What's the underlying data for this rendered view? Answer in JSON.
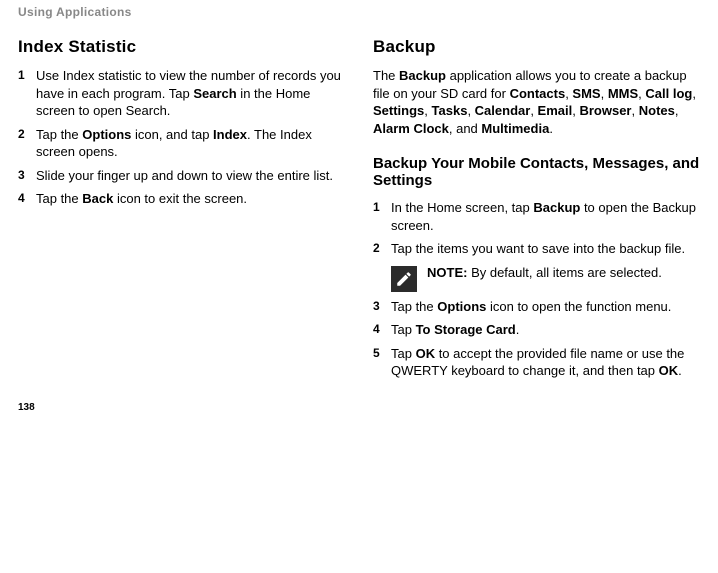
{
  "header": "Using Applications",
  "pageNumber": "138",
  "left": {
    "title": "Index Statistic",
    "steps": [
      {
        "n": "1",
        "parts": [
          {
            "t": "Use Index statistic to view the number of records you have in each program. Tap "
          },
          {
            "t": "Search",
            "b": true
          },
          {
            "t": " in the Home screen to open Search."
          }
        ]
      },
      {
        "n": "2",
        "parts": [
          {
            "t": "Tap the "
          },
          {
            "t": "Options",
            "b": true
          },
          {
            "t": " icon, and tap "
          },
          {
            "t": "Index",
            "b": true
          },
          {
            "t": ". The Index screen opens."
          }
        ]
      },
      {
        "n": "3",
        "parts": [
          {
            "t": "Slide your finger up and down to view the entire list."
          }
        ]
      },
      {
        "n": "4",
        "parts": [
          {
            "t": "Tap the "
          },
          {
            "t": "Back",
            "b": true
          },
          {
            "t": " icon to exit the screen."
          }
        ]
      }
    ]
  },
  "right": {
    "title": "Backup",
    "introParts": [
      {
        "t": "The "
      },
      {
        "t": "Backup",
        "b": true
      },
      {
        "t": " application allows you to create a backup file on your SD card for "
      },
      {
        "t": "Contacts",
        "b": true
      },
      {
        "t": ", "
      },
      {
        "t": "SMS",
        "b": true
      },
      {
        "t": ", "
      },
      {
        "t": "MMS",
        "b": true
      },
      {
        "t": ", "
      },
      {
        "t": "Call log",
        "b": true
      },
      {
        "t": ", "
      },
      {
        "t": "Settings",
        "b": true
      },
      {
        "t": ", "
      },
      {
        "t": "Tasks",
        "b": true
      },
      {
        "t": ", "
      },
      {
        "t": "Calendar",
        "b": true
      },
      {
        "t": ", "
      },
      {
        "t": "Email",
        "b": true
      },
      {
        "t": ", "
      },
      {
        "t": "Browser",
        "b": true
      },
      {
        "t": ", "
      },
      {
        "t": "Notes",
        "b": true
      },
      {
        "t": ", "
      },
      {
        "t": "Alarm Clock",
        "b": true
      },
      {
        "t": ", and "
      },
      {
        "t": "Multimedia",
        "b": true
      },
      {
        "t": "."
      }
    ],
    "subTitle": "Backup Your Mobile Contacts, Messages, and Settings",
    "steps": [
      {
        "n": "1",
        "parts": [
          {
            "t": "In the Home screen, tap "
          },
          {
            "t": "Backup",
            "b": true
          },
          {
            "t": " to open the Backup screen."
          }
        ]
      },
      {
        "n": "2",
        "parts": [
          {
            "t": "Tap the items you want to save into the backup file."
          }
        ]
      },
      {
        "note": {
          "labelParts": [
            {
              "t": "NOTE:",
              "b": true
            },
            {
              "t": " By default, all items are selected."
            }
          ]
        }
      },
      {
        "n": "3",
        "parts": [
          {
            "t": "Tap the "
          },
          {
            "t": "Options",
            "b": true
          },
          {
            "t": " icon to open the function menu."
          }
        ]
      },
      {
        "n": "4",
        "parts": [
          {
            "t": "Tap "
          },
          {
            "t": "To Storage Card",
            "b": true
          },
          {
            "t": "."
          }
        ]
      },
      {
        "n": "5",
        "parts": [
          {
            "t": "Tap "
          },
          {
            "t": "OK",
            "b": true
          },
          {
            "t": " to accept the provided file name or use the QWERTY keyboard to change it, and then tap "
          },
          {
            "t": "OK",
            "b": true
          },
          {
            "t": "."
          }
        ]
      }
    ]
  }
}
